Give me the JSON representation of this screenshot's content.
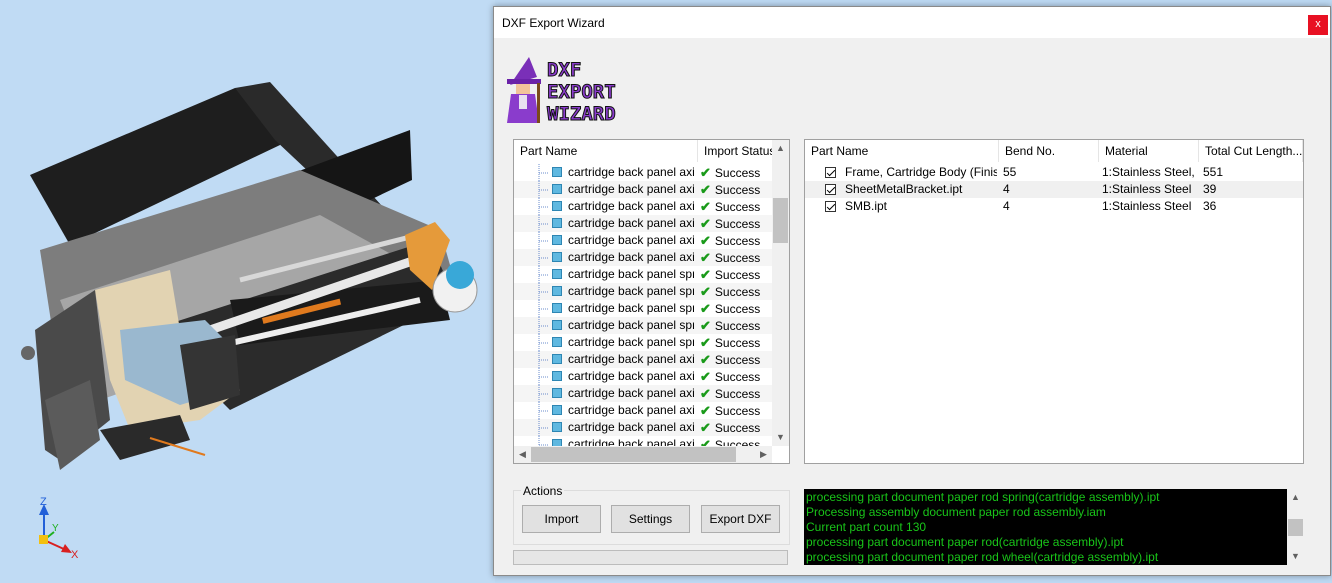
{
  "dialog": {
    "title": "DXF Export Wizard",
    "close_glyph": "x",
    "logo_lines": [
      "DXF",
      "EXPORT",
      "WIZARD"
    ]
  },
  "import_list": {
    "headers": [
      "Part Name",
      "Import Status"
    ],
    "rows": [
      {
        "name": "cartridge back panel axi...",
        "status": "Success"
      },
      {
        "name": "cartridge back panel axi...",
        "status": "Success"
      },
      {
        "name": "cartridge back panel axi...",
        "status": "Success"
      },
      {
        "name": "cartridge back panel axi...",
        "status": "Success"
      },
      {
        "name": "cartridge back panel axi...",
        "status": "Success"
      },
      {
        "name": "cartridge back panel axi...",
        "status": "Success"
      },
      {
        "name": "cartridge back panel spri...",
        "status": "Success"
      },
      {
        "name": "cartridge back panel spri...",
        "status": "Success"
      },
      {
        "name": "cartridge back panel spri...",
        "status": "Success"
      },
      {
        "name": "cartridge back panel spri...",
        "status": "Success"
      },
      {
        "name": "cartridge back panel spri...",
        "status": "Success"
      },
      {
        "name": "cartridge back panel axi...",
        "status": "Success"
      },
      {
        "name": "cartridge back panel axi...",
        "status": "Success"
      },
      {
        "name": "cartridge back panel axi...",
        "status": "Success"
      },
      {
        "name": "cartridge back panel axi...",
        "status": "Success"
      },
      {
        "name": "cartridge back panel axi...",
        "status": "Success"
      },
      {
        "name": "cartridge back panel axi...",
        "status": "Success"
      }
    ]
  },
  "parts_table": {
    "headers": [
      "Part Name",
      "Bend No.",
      "Material",
      "Total Cut Length..."
    ],
    "rows": [
      {
        "checked": true,
        "name": "Frame, Cartridge Body (Finish...",
        "bends": "55",
        "material": "1:Stainless Steel, ...",
        "cut_length": "551"
      },
      {
        "checked": true,
        "name": "SheetMetalBracket.ipt",
        "bends": "4",
        "material": "1:Stainless Steel",
        "cut_length": "39"
      },
      {
        "checked": true,
        "name": "SMB.ipt",
        "bends": "4",
        "material": "1:Stainless Steel",
        "cut_length": "36"
      }
    ]
  },
  "actions": {
    "group_label": "Actions",
    "import_label": "Import",
    "settings_label": "Settings",
    "export_label": "Export DXF"
  },
  "log": {
    "lines": [
      "processing part document paper rod spring(cartridge assembly).ipt",
      "Processing assembly document paper rod assembly.iam",
      "Current part count 130",
      "processing part document paper rod(cartridge assembly).ipt",
      "processing part document paper rod wheel(cartridge assembly).ipt"
    ]
  },
  "triad": {
    "x": "X",
    "y": "Y",
    "z": "Z"
  },
  "colors": {
    "success": "#1a9a1a",
    "log_text": "#19c419",
    "close": "#e81123"
  }
}
